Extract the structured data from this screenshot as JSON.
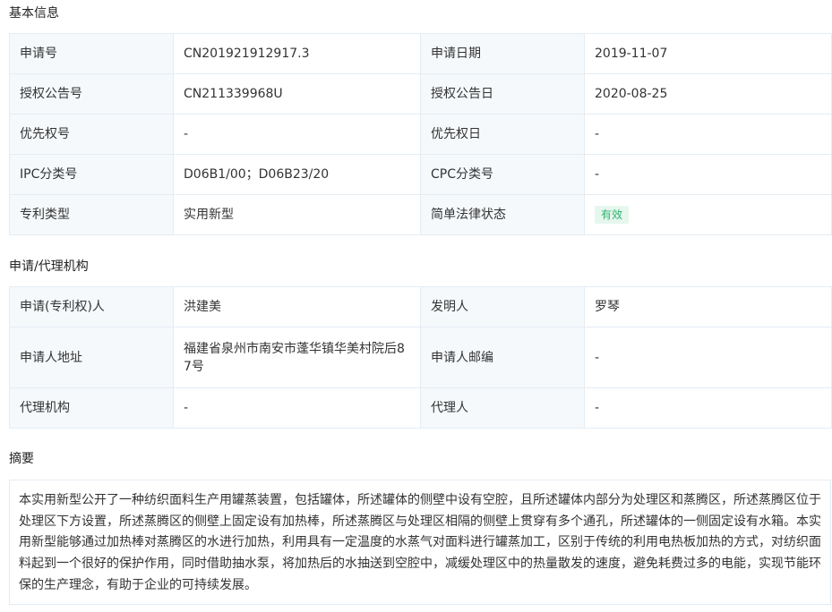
{
  "basic_info": {
    "title": "基本信息",
    "rows": [
      {
        "l1": "申请号",
        "v1": "CN201921912917.3",
        "l2": "申请日期",
        "v2": "2019-11-07"
      },
      {
        "l1": "授权公告号",
        "v1": "CN211339968U",
        "l2": "授权公告日",
        "v2": "2020-08-25"
      },
      {
        "l1": "优先权号",
        "v1": "-",
        "l2": "优先权日",
        "v2": "-"
      },
      {
        "l1": "IPC分类号",
        "v1": "D06B1/00；D06B23/20",
        "l2": "CPC分类号",
        "v2": "-"
      },
      {
        "l1": "专利类型",
        "v1": "实用新型",
        "l2": "简单法律状态",
        "v2": "有效"
      }
    ],
    "status_color": "#2fb36c",
    "status_bg": "#e6f7ee"
  },
  "agency": {
    "title": "申请/代理机构",
    "rows": [
      {
        "l1": "申请(专利权)人",
        "v1": "洪建美",
        "l2": "发明人",
        "v2": "罗琴"
      },
      {
        "l1": "申请人地址",
        "v1": "福建省泉州市南安市蓬华镇华美村院后87号",
        "l2": "申请人邮编",
        "v2": "-"
      },
      {
        "l1": "代理机构",
        "v1": "-",
        "l2": "代理人",
        "v2": "-"
      }
    ]
  },
  "abstract": {
    "title": "摘要",
    "text": "本实用新型公开了一种纺织面料生产用罐蒸装置，包括罐体，所述罐体的侧壁中设有空腔，且所述罐体内部分为处理区和蒸腾区，所述蒸腾区位于处理区下方设置，所述蒸腾区的侧壁上固定设有加热棒，所述蒸腾区与处理区相隔的侧壁上贯穿有多个通孔，所述罐体的一侧固定设有水箱。本实用新型能够通过加热棒对蒸腾区的水进行加热，利用具有一定温度的水蒸气对面料进行罐蒸加工，区别于传统的利用电热板加热的方式，对纺织面料起到一个很好的保护作用，同时借助抽水泵，将加热后的水抽送到空腔中，减缓处理区中的热量散发的速度，避免耗费过多的电能，实现节能环保的生产理念，有助于企业的可持续发展。"
  },
  "colors": {
    "label_bg": "#f5f9fc",
    "border": "#e4ecf3",
    "text": "#333333"
  }
}
